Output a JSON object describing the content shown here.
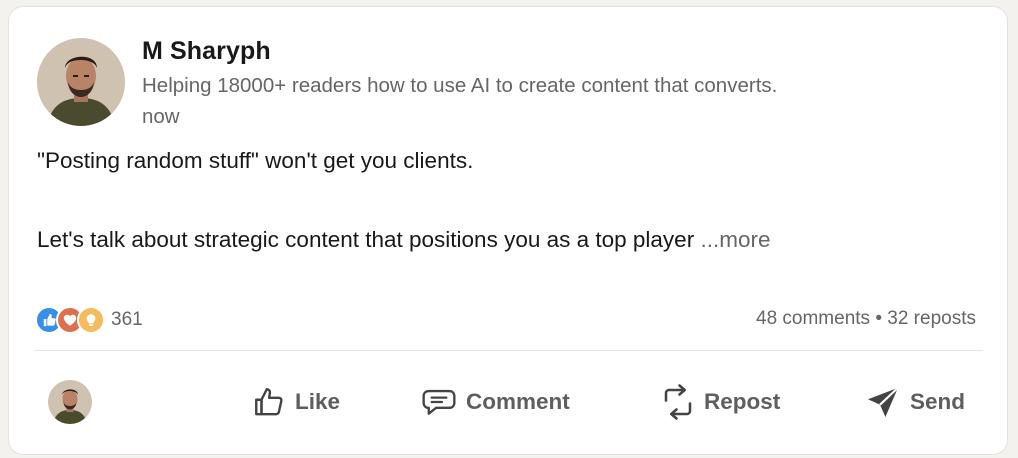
{
  "post": {
    "author": {
      "name": "M Sharyph",
      "headline": "Helping 18000+ readers how to use AI to create content that converts.",
      "timestamp": "now"
    },
    "text": {
      "line1": "\"Posting random stuff\" won't get you clients.",
      "line2": "Let's talk about strategic content that positions you as a top player",
      "more_label": "...more"
    },
    "reactions": {
      "icons": [
        "like-icon",
        "love-icon",
        "insightful-icon"
      ],
      "count": "361"
    },
    "social": {
      "comments": "48 comments",
      "separator": "•",
      "reposts": "32 reposts"
    },
    "actions": {
      "like": "Like",
      "comment": "Comment",
      "repost": "Repost",
      "send": "Send"
    },
    "colors": {
      "like": "#378fe9",
      "love": "#df704d",
      "insightful": "#f5bb5c",
      "text_primary": "#191919",
      "text_secondary": "#666666"
    }
  }
}
